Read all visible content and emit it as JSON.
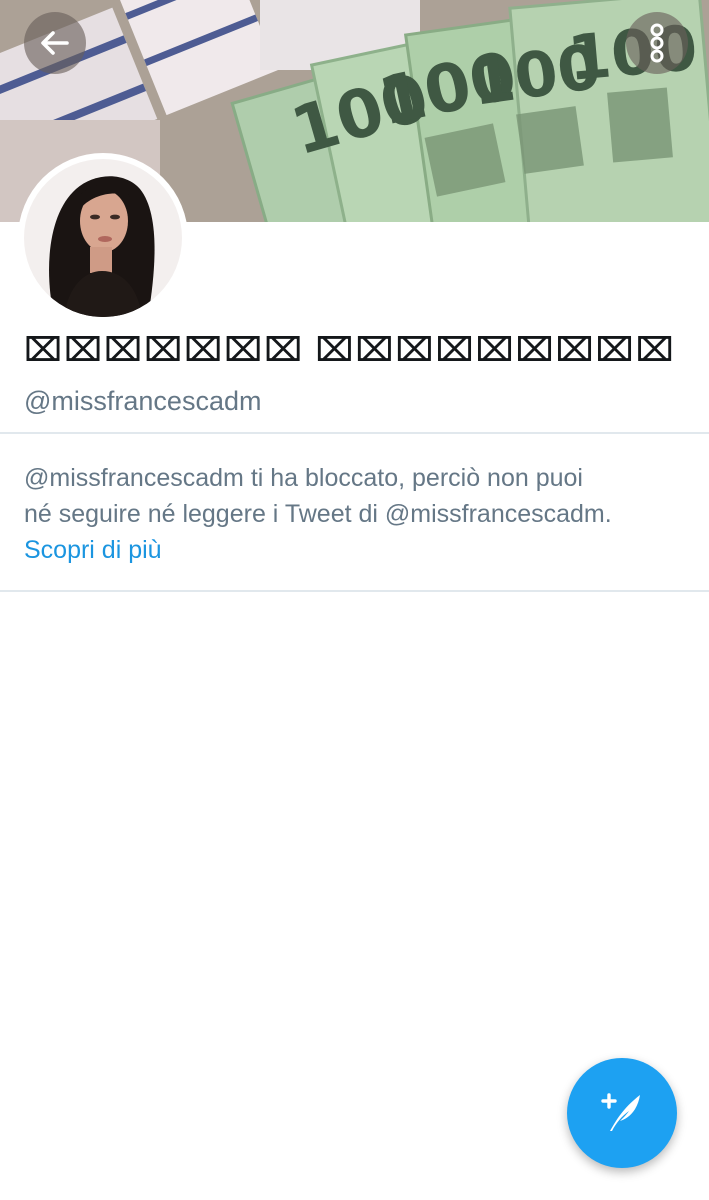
{
  "profile": {
    "display_name": "⌧⌧⌧⌧⌧⌧⌧ ⌧⌧⌧⌧⌧⌧⌧⌧⌧",
    "handle": "@missfrancescadm"
  },
  "notice": {
    "line1": "@missfrancescadm ti ha bloccato, perciò non puoi",
    "line2": "né seguire né leggere i Tweet di @missfrancescadm.",
    "learn_more": "Scopri di più"
  },
  "banner_note": {
    "denomination": "100"
  },
  "icons": {
    "back": "arrow-left-icon",
    "more": "more-vertical-icon",
    "compose": "compose-tweet-icon"
  },
  "colors": {
    "accent": "#1da1f2",
    "link": "#1b95e0",
    "text_secondary": "#657786",
    "divider": "#e1e8ed"
  }
}
